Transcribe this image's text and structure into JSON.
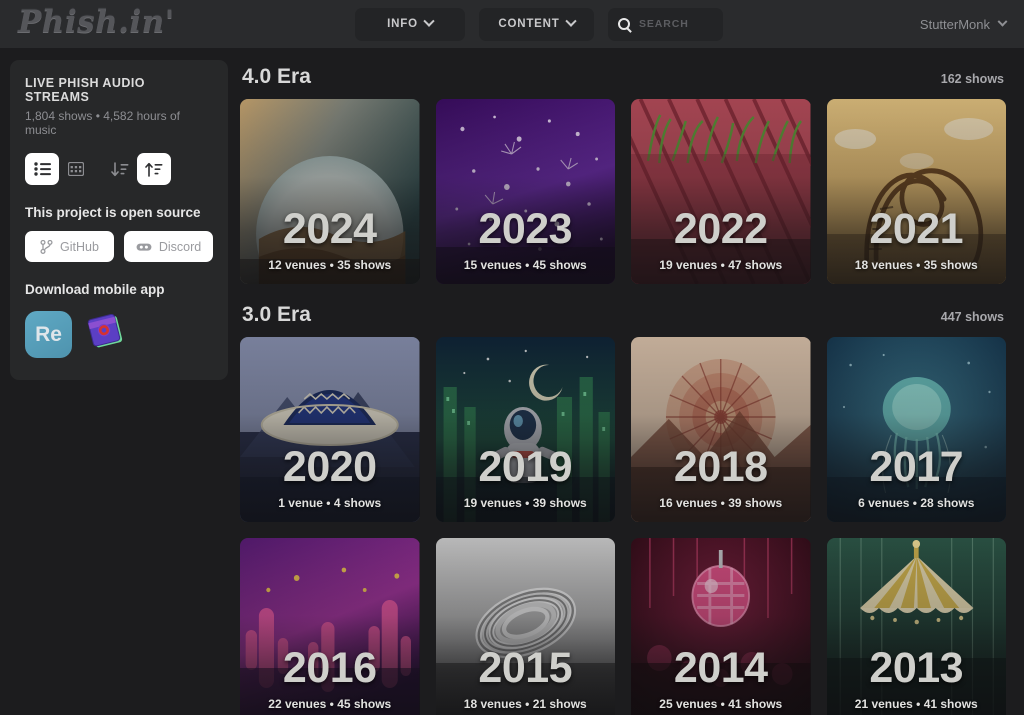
{
  "header": {
    "logo": "Phish.in'",
    "nav": [
      {
        "label": "INFO",
        "icon": "chevron-down-icon"
      },
      {
        "label": "CONTENT",
        "icon": "chevron-down-icon"
      }
    ],
    "search": {
      "placeholder": "SEARCH",
      "value": "",
      "icon": "search-icon"
    },
    "user": {
      "name": "StutterMonk",
      "icon": "chevron-down-icon"
    }
  },
  "sidebar": {
    "title": "LIVE PHISH AUDIO STREAMS",
    "subtitle": "1,804 shows • 4,582 hours of music",
    "view_buttons": [
      {
        "name": "list-view",
        "icon": "list-icon",
        "active": true
      },
      {
        "name": "grid-view",
        "icon": "grid-icon",
        "active": false
      }
    ],
    "sort_buttons": [
      {
        "name": "sort-descending",
        "icon": "sort-desc-icon",
        "active": false
      },
      {
        "name": "sort-ascending",
        "icon": "sort-asc-icon",
        "active": true
      }
    ],
    "open_source_heading": "This project is open source",
    "links": [
      {
        "label": "GitHub",
        "icon": "git-branch-icon"
      },
      {
        "label": "Discord",
        "icon": "discord-icon"
      }
    ],
    "download_heading": "Download mobile app",
    "apps": [
      {
        "name": "relisten-app-icon",
        "label": "Re"
      },
      {
        "name": "phishod-app-icon",
        "label": ""
      }
    ]
  },
  "eras": [
    {
      "title": "4.0 Era",
      "count": "162 shows",
      "cards": [
        {
          "year": "2024",
          "meta": "12 venues • 35 shows",
          "art": "desert-dome"
        },
        {
          "year": "2023",
          "meta": "15 venues • 45 shows",
          "art": "purple-sparks"
        },
        {
          "year": "2022",
          "meta": "19 venues • 47 shows",
          "art": "red-deck-grass"
        },
        {
          "year": "2021",
          "meta": "18 venues • 35 shows",
          "art": "coaster-loop"
        }
      ]
    },
    {
      "title": "3.0 Era",
      "count": "447 shows",
      "cards": [
        {
          "year": "2020",
          "meta": "1 venue • 4 shows",
          "art": "sombrero"
        },
        {
          "year": "2019",
          "meta": "19 venues • 39 shows",
          "art": "astronaut-city"
        },
        {
          "year": "2018",
          "meta": "16 venues • 39 shows",
          "art": "kaleidoscope"
        },
        {
          "year": "2017",
          "meta": "6 venues • 28 shows",
          "art": "jellyfish"
        },
        {
          "year": "2016",
          "meta": "22 venues • 45 shows",
          "art": "neon-cactus"
        },
        {
          "year": "2015",
          "meta": "18 venues • 21 shows",
          "art": "chrome-rings"
        },
        {
          "year": "2014",
          "meta": "25 venues • 41 shows",
          "art": "disco-ball"
        },
        {
          "year": "2013",
          "meta": "21 venues • 41 shows",
          "art": "circus-tent"
        }
      ]
    }
  ]
}
